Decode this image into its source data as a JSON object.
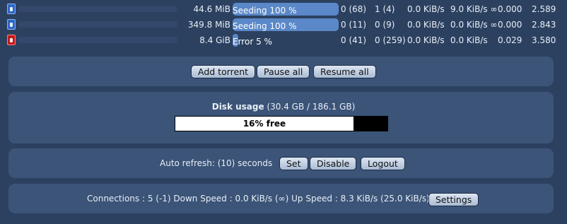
{
  "torrents": [
    {
      "status_icon": "seeding-icon",
      "size": "44.6 MiB",
      "progress_label": "Seeding 100 %",
      "progress": 100,
      "seeds": "0 (68)",
      "peers": "1 (4)",
      "down_speed": "0.0 KiB/s",
      "up_speed": "9.0 KiB/s ∞",
      "ratio": "0.000",
      "avail": "2.589"
    },
    {
      "status_icon": "seeding-icon",
      "size": "349.8 MiB",
      "progress_label": "Seeding 100 %",
      "progress": 100,
      "seeds": "0 (11)",
      "peers": "0 (9)",
      "down_speed": "0.0 KiB/s",
      "up_speed": "0.0 KiB/s ∞",
      "ratio": "0.000",
      "avail": "2.843"
    },
    {
      "status_icon": "error-icon",
      "size": "8.4 GiB",
      "progress_label": "Error 5 %",
      "progress": 5,
      "seeds": "0 (41)",
      "peers": "0 (259)",
      "down_speed": "0.0 KiB/s",
      "up_speed": "0.0 KiB/s",
      "ratio": "0.029",
      "avail": "3.580"
    }
  ],
  "actions": {
    "add_torrent": "Add torrent",
    "pause_all": "Pause all",
    "resume_all": "Resume all"
  },
  "disk": {
    "title": "Disk usage",
    "detail": "(30.4 GB / 186.1 GB)",
    "free_label": "16% free",
    "free_fraction": 0.16
  },
  "refresh": {
    "label": "Auto refresh: (10) seconds",
    "set": "Set",
    "disable": "Disable",
    "logout": "Logout"
  },
  "status": {
    "text": "Connections : 5 (-1) Down Speed : 0.0 KiB/s (∞) Up Speed : 8.3 KiB/s (25.0 KiB/s)",
    "settings": "Settings"
  },
  "colors": {
    "background": "#2c4160",
    "panel": "#3b5478",
    "progress_fill": "#5a88c8",
    "error_icon": "#c81818",
    "seeding_icon": "#2b67c8"
  }
}
